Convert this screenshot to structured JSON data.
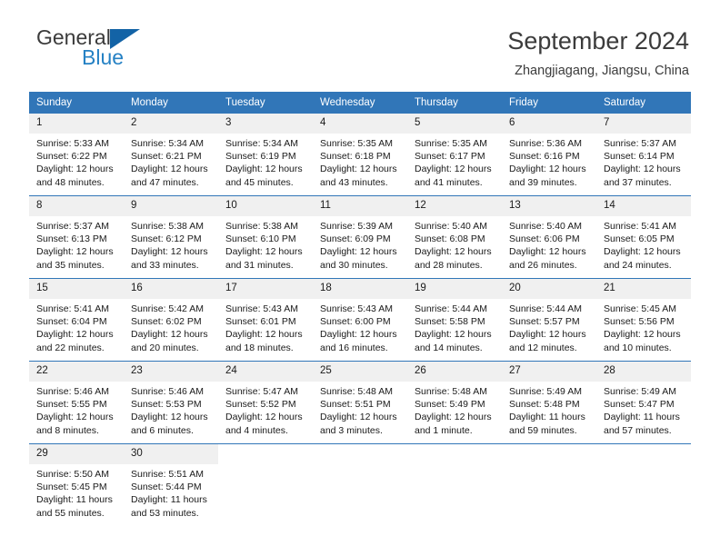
{
  "brand": {
    "name_part1": "General",
    "name_part2": "Blue",
    "triangle_icon": "triangle-icon",
    "color_dark": "#3b3b3b",
    "color_blue": "#2581c4",
    "color_triangle": "#1363a6"
  },
  "header": {
    "title": "September 2024",
    "subtitle": "Zhangjiagang, Jiangsu, China",
    "accent_color": "#3176b8"
  },
  "weekdays": [
    "Sunday",
    "Monday",
    "Tuesday",
    "Wednesday",
    "Thursday",
    "Friday",
    "Saturday"
  ],
  "weeks": [
    [
      {
        "day": "1",
        "sunrise": "Sunrise: 5:33 AM",
        "sunset": "Sunset: 6:22 PM",
        "daylight_line1": "Daylight: 12 hours",
        "daylight_line2": "and 48 minutes."
      },
      {
        "day": "2",
        "sunrise": "Sunrise: 5:34 AM",
        "sunset": "Sunset: 6:21 PM",
        "daylight_line1": "Daylight: 12 hours",
        "daylight_line2": "and 47 minutes."
      },
      {
        "day": "3",
        "sunrise": "Sunrise: 5:34 AM",
        "sunset": "Sunset: 6:19 PM",
        "daylight_line1": "Daylight: 12 hours",
        "daylight_line2": "and 45 minutes."
      },
      {
        "day": "4",
        "sunrise": "Sunrise: 5:35 AM",
        "sunset": "Sunset: 6:18 PM",
        "daylight_line1": "Daylight: 12 hours",
        "daylight_line2": "and 43 minutes."
      },
      {
        "day": "5",
        "sunrise": "Sunrise: 5:35 AM",
        "sunset": "Sunset: 6:17 PM",
        "daylight_line1": "Daylight: 12 hours",
        "daylight_line2": "and 41 minutes."
      },
      {
        "day": "6",
        "sunrise": "Sunrise: 5:36 AM",
        "sunset": "Sunset: 6:16 PM",
        "daylight_line1": "Daylight: 12 hours",
        "daylight_line2": "and 39 minutes."
      },
      {
        "day": "7",
        "sunrise": "Sunrise: 5:37 AM",
        "sunset": "Sunset: 6:14 PM",
        "daylight_line1": "Daylight: 12 hours",
        "daylight_line2": "and 37 minutes."
      }
    ],
    [
      {
        "day": "8",
        "sunrise": "Sunrise: 5:37 AM",
        "sunset": "Sunset: 6:13 PM",
        "daylight_line1": "Daylight: 12 hours",
        "daylight_line2": "and 35 minutes."
      },
      {
        "day": "9",
        "sunrise": "Sunrise: 5:38 AM",
        "sunset": "Sunset: 6:12 PM",
        "daylight_line1": "Daylight: 12 hours",
        "daylight_line2": "and 33 minutes."
      },
      {
        "day": "10",
        "sunrise": "Sunrise: 5:38 AM",
        "sunset": "Sunset: 6:10 PM",
        "daylight_line1": "Daylight: 12 hours",
        "daylight_line2": "and 31 minutes."
      },
      {
        "day": "11",
        "sunrise": "Sunrise: 5:39 AM",
        "sunset": "Sunset: 6:09 PM",
        "daylight_line1": "Daylight: 12 hours",
        "daylight_line2": "and 30 minutes."
      },
      {
        "day": "12",
        "sunrise": "Sunrise: 5:40 AM",
        "sunset": "Sunset: 6:08 PM",
        "daylight_line1": "Daylight: 12 hours",
        "daylight_line2": "and 28 minutes."
      },
      {
        "day": "13",
        "sunrise": "Sunrise: 5:40 AM",
        "sunset": "Sunset: 6:06 PM",
        "daylight_line1": "Daylight: 12 hours",
        "daylight_line2": "and 26 minutes."
      },
      {
        "day": "14",
        "sunrise": "Sunrise: 5:41 AM",
        "sunset": "Sunset: 6:05 PM",
        "daylight_line1": "Daylight: 12 hours",
        "daylight_line2": "and 24 minutes."
      }
    ],
    [
      {
        "day": "15",
        "sunrise": "Sunrise: 5:41 AM",
        "sunset": "Sunset: 6:04 PM",
        "daylight_line1": "Daylight: 12 hours",
        "daylight_line2": "and 22 minutes."
      },
      {
        "day": "16",
        "sunrise": "Sunrise: 5:42 AM",
        "sunset": "Sunset: 6:02 PM",
        "daylight_line1": "Daylight: 12 hours",
        "daylight_line2": "and 20 minutes."
      },
      {
        "day": "17",
        "sunrise": "Sunrise: 5:43 AM",
        "sunset": "Sunset: 6:01 PM",
        "daylight_line1": "Daylight: 12 hours",
        "daylight_line2": "and 18 minutes."
      },
      {
        "day": "18",
        "sunrise": "Sunrise: 5:43 AM",
        "sunset": "Sunset: 6:00 PM",
        "daylight_line1": "Daylight: 12 hours",
        "daylight_line2": "and 16 minutes."
      },
      {
        "day": "19",
        "sunrise": "Sunrise: 5:44 AM",
        "sunset": "Sunset: 5:58 PM",
        "daylight_line1": "Daylight: 12 hours",
        "daylight_line2": "and 14 minutes."
      },
      {
        "day": "20",
        "sunrise": "Sunrise: 5:44 AM",
        "sunset": "Sunset: 5:57 PM",
        "daylight_line1": "Daylight: 12 hours",
        "daylight_line2": "and 12 minutes."
      },
      {
        "day": "21",
        "sunrise": "Sunrise: 5:45 AM",
        "sunset": "Sunset: 5:56 PM",
        "daylight_line1": "Daylight: 12 hours",
        "daylight_line2": "and 10 minutes."
      }
    ],
    [
      {
        "day": "22",
        "sunrise": "Sunrise: 5:46 AM",
        "sunset": "Sunset: 5:55 PM",
        "daylight_line1": "Daylight: 12 hours",
        "daylight_line2": "and 8 minutes."
      },
      {
        "day": "23",
        "sunrise": "Sunrise: 5:46 AM",
        "sunset": "Sunset: 5:53 PM",
        "daylight_line1": "Daylight: 12 hours",
        "daylight_line2": "and 6 minutes."
      },
      {
        "day": "24",
        "sunrise": "Sunrise: 5:47 AM",
        "sunset": "Sunset: 5:52 PM",
        "daylight_line1": "Daylight: 12 hours",
        "daylight_line2": "and 4 minutes."
      },
      {
        "day": "25",
        "sunrise": "Sunrise: 5:48 AM",
        "sunset": "Sunset: 5:51 PM",
        "daylight_line1": "Daylight: 12 hours",
        "daylight_line2": "and 3 minutes."
      },
      {
        "day": "26",
        "sunrise": "Sunrise: 5:48 AM",
        "sunset": "Sunset: 5:49 PM",
        "daylight_line1": "Daylight: 12 hours",
        "daylight_line2": "and 1 minute."
      },
      {
        "day": "27",
        "sunrise": "Sunrise: 5:49 AM",
        "sunset": "Sunset: 5:48 PM",
        "daylight_line1": "Daylight: 11 hours",
        "daylight_line2": "and 59 minutes."
      },
      {
        "day": "28",
        "sunrise": "Sunrise: 5:49 AM",
        "sunset": "Sunset: 5:47 PM",
        "daylight_line1": "Daylight: 11 hours",
        "daylight_line2": "and 57 minutes."
      }
    ],
    [
      {
        "day": "29",
        "sunrise": "Sunrise: 5:50 AM",
        "sunset": "Sunset: 5:45 PM",
        "daylight_line1": "Daylight: 11 hours",
        "daylight_line2": "and 55 minutes."
      },
      {
        "day": "30",
        "sunrise": "Sunrise: 5:51 AM",
        "sunset": "Sunset: 5:44 PM",
        "daylight_line1": "Daylight: 11 hours",
        "daylight_line2": "and 53 minutes."
      },
      {
        "day": "",
        "sunrise": "",
        "sunset": "",
        "daylight_line1": "",
        "daylight_line2": ""
      },
      {
        "day": "",
        "sunrise": "",
        "sunset": "",
        "daylight_line1": "",
        "daylight_line2": ""
      },
      {
        "day": "",
        "sunrise": "",
        "sunset": "",
        "daylight_line1": "",
        "daylight_line2": ""
      },
      {
        "day": "",
        "sunrise": "",
        "sunset": "",
        "daylight_line1": "",
        "daylight_line2": ""
      },
      {
        "day": "",
        "sunrise": "",
        "sunset": "",
        "daylight_line1": "",
        "daylight_line2": ""
      }
    ]
  ]
}
